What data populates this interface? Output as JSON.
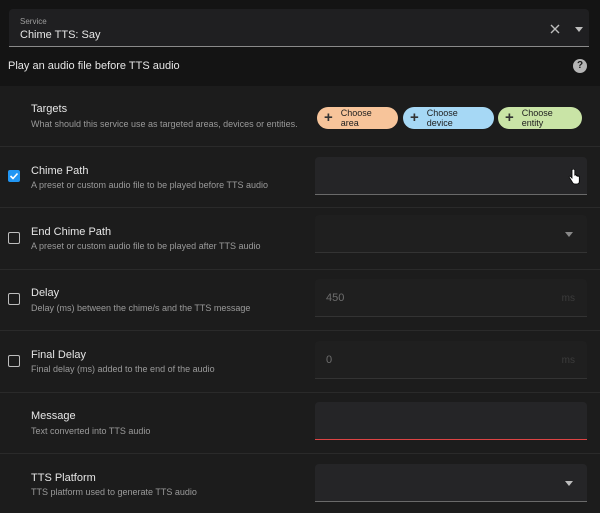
{
  "service": {
    "label": "Service",
    "value": "Chime TTS: Say"
  },
  "description": "Play an audio file before TTS audio",
  "help_icon": "question-mark-icon",
  "targets": {
    "title": "Targets",
    "subtitle": "What should this service use as targeted areas, devices or entities.",
    "chips": [
      {
        "label": "Choose area",
        "color": "#f7c49a"
      },
      {
        "label": "Choose device",
        "color": "#a6d8f5"
      },
      {
        "label": "Choose entity",
        "color": "#c9e4a6"
      }
    ]
  },
  "fields": [
    {
      "title": "Chime Path",
      "subtitle": "A preset or custom audio file to be played before TTS audio",
      "checked": true,
      "value": ""
    },
    {
      "title": "End Chime Path",
      "subtitle": "A preset or custom audio file to be played after TTS audio",
      "checked": false,
      "value": ""
    },
    {
      "title": "Delay",
      "subtitle": "Delay (ms) between the chime/s and the TTS message",
      "checked": false,
      "value": "450",
      "unit": "ms"
    },
    {
      "title": "Final Delay",
      "subtitle": "Final delay (ms) added to the end of the audio",
      "checked": false,
      "value": "0",
      "unit": "ms"
    },
    {
      "title": "Message",
      "subtitle": "Text converted into TTS audio",
      "value": ""
    },
    {
      "title": "TTS Platform",
      "subtitle": "TTS platform used to generate TTS audio",
      "value": ""
    }
  ],
  "colors": {
    "accent": "#2196f3",
    "error": "#dd4444"
  }
}
